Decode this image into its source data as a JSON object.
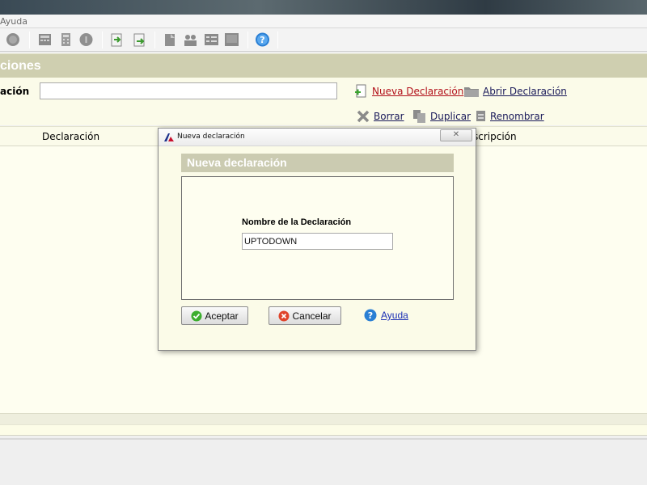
{
  "menubar": {
    "help_menu": "Ayuda"
  },
  "toolbar": {
    "icons": [
      "search-icon",
      "calculator-icon",
      "calculator-alt-icon",
      "info-icon",
      "import-icon",
      "export-icon",
      "edit-icon",
      "users-icon",
      "list-icon",
      "monitor-icon",
      "help-icon"
    ]
  },
  "section": {
    "title": "ciones"
  },
  "form": {
    "field_label": "ación",
    "field_value": ""
  },
  "actions": {
    "new": "Nueva Declaración",
    "open": "Abrir Declaración",
    "delete": "Borrar",
    "duplicate": "Duplicar",
    "rename": "Renombrar"
  },
  "table": {
    "columns": [
      "Declaración",
      "scripción"
    ]
  },
  "dialog": {
    "window_title": "Nueva declaración",
    "close_glyph": "✕",
    "header": "Nueva declaración",
    "field_label": "Nombre de la Declaración",
    "field_value": "UPTODOWN",
    "accept": "Aceptar",
    "cancel": "Cancelar",
    "help": "Ayuda"
  },
  "colors": {
    "section_header_bg": "#cfcfb0",
    "panel_bg": "#fbfbe9",
    "link_red": "#b2101a",
    "link_blue": "#1b2fb5"
  }
}
